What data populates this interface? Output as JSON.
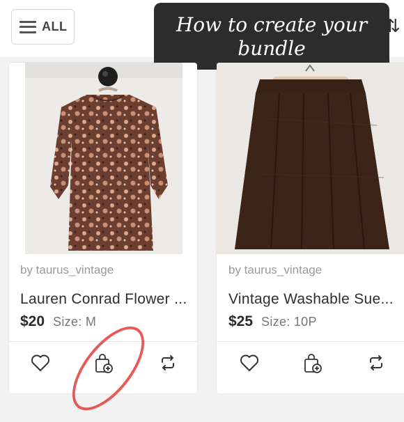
{
  "toolbar": {
    "all_label": "ALL",
    "menu_icon": "hamburger-menu-icon",
    "sort_icon": "sort-arrows-icon"
  },
  "banner": {
    "line1": "How to create your",
    "line2": "bundle"
  },
  "listings": [
    {
      "seller": "by taurus_vintage",
      "title": "Lauren Conrad Flower ...",
      "price": "$20",
      "size": "Size: M",
      "actions": [
        "heart-icon",
        "bundle-bag-add-icon",
        "share-repost-icon"
      ]
    },
    {
      "seller": "by taurus_vintage",
      "title": "Vintage Washable Sue...",
      "price": "$25",
      "size": "Size: 10P",
      "actions": [
        "heart-icon",
        "bundle-bag-add-icon",
        "share-repost-icon"
      ]
    }
  ],
  "colors": {
    "banner_bg": "#2c2c2c",
    "annotation_red": "#e43c3c",
    "blouse_base": "#6b3e30",
    "skirt_base": "#3a2217"
  }
}
